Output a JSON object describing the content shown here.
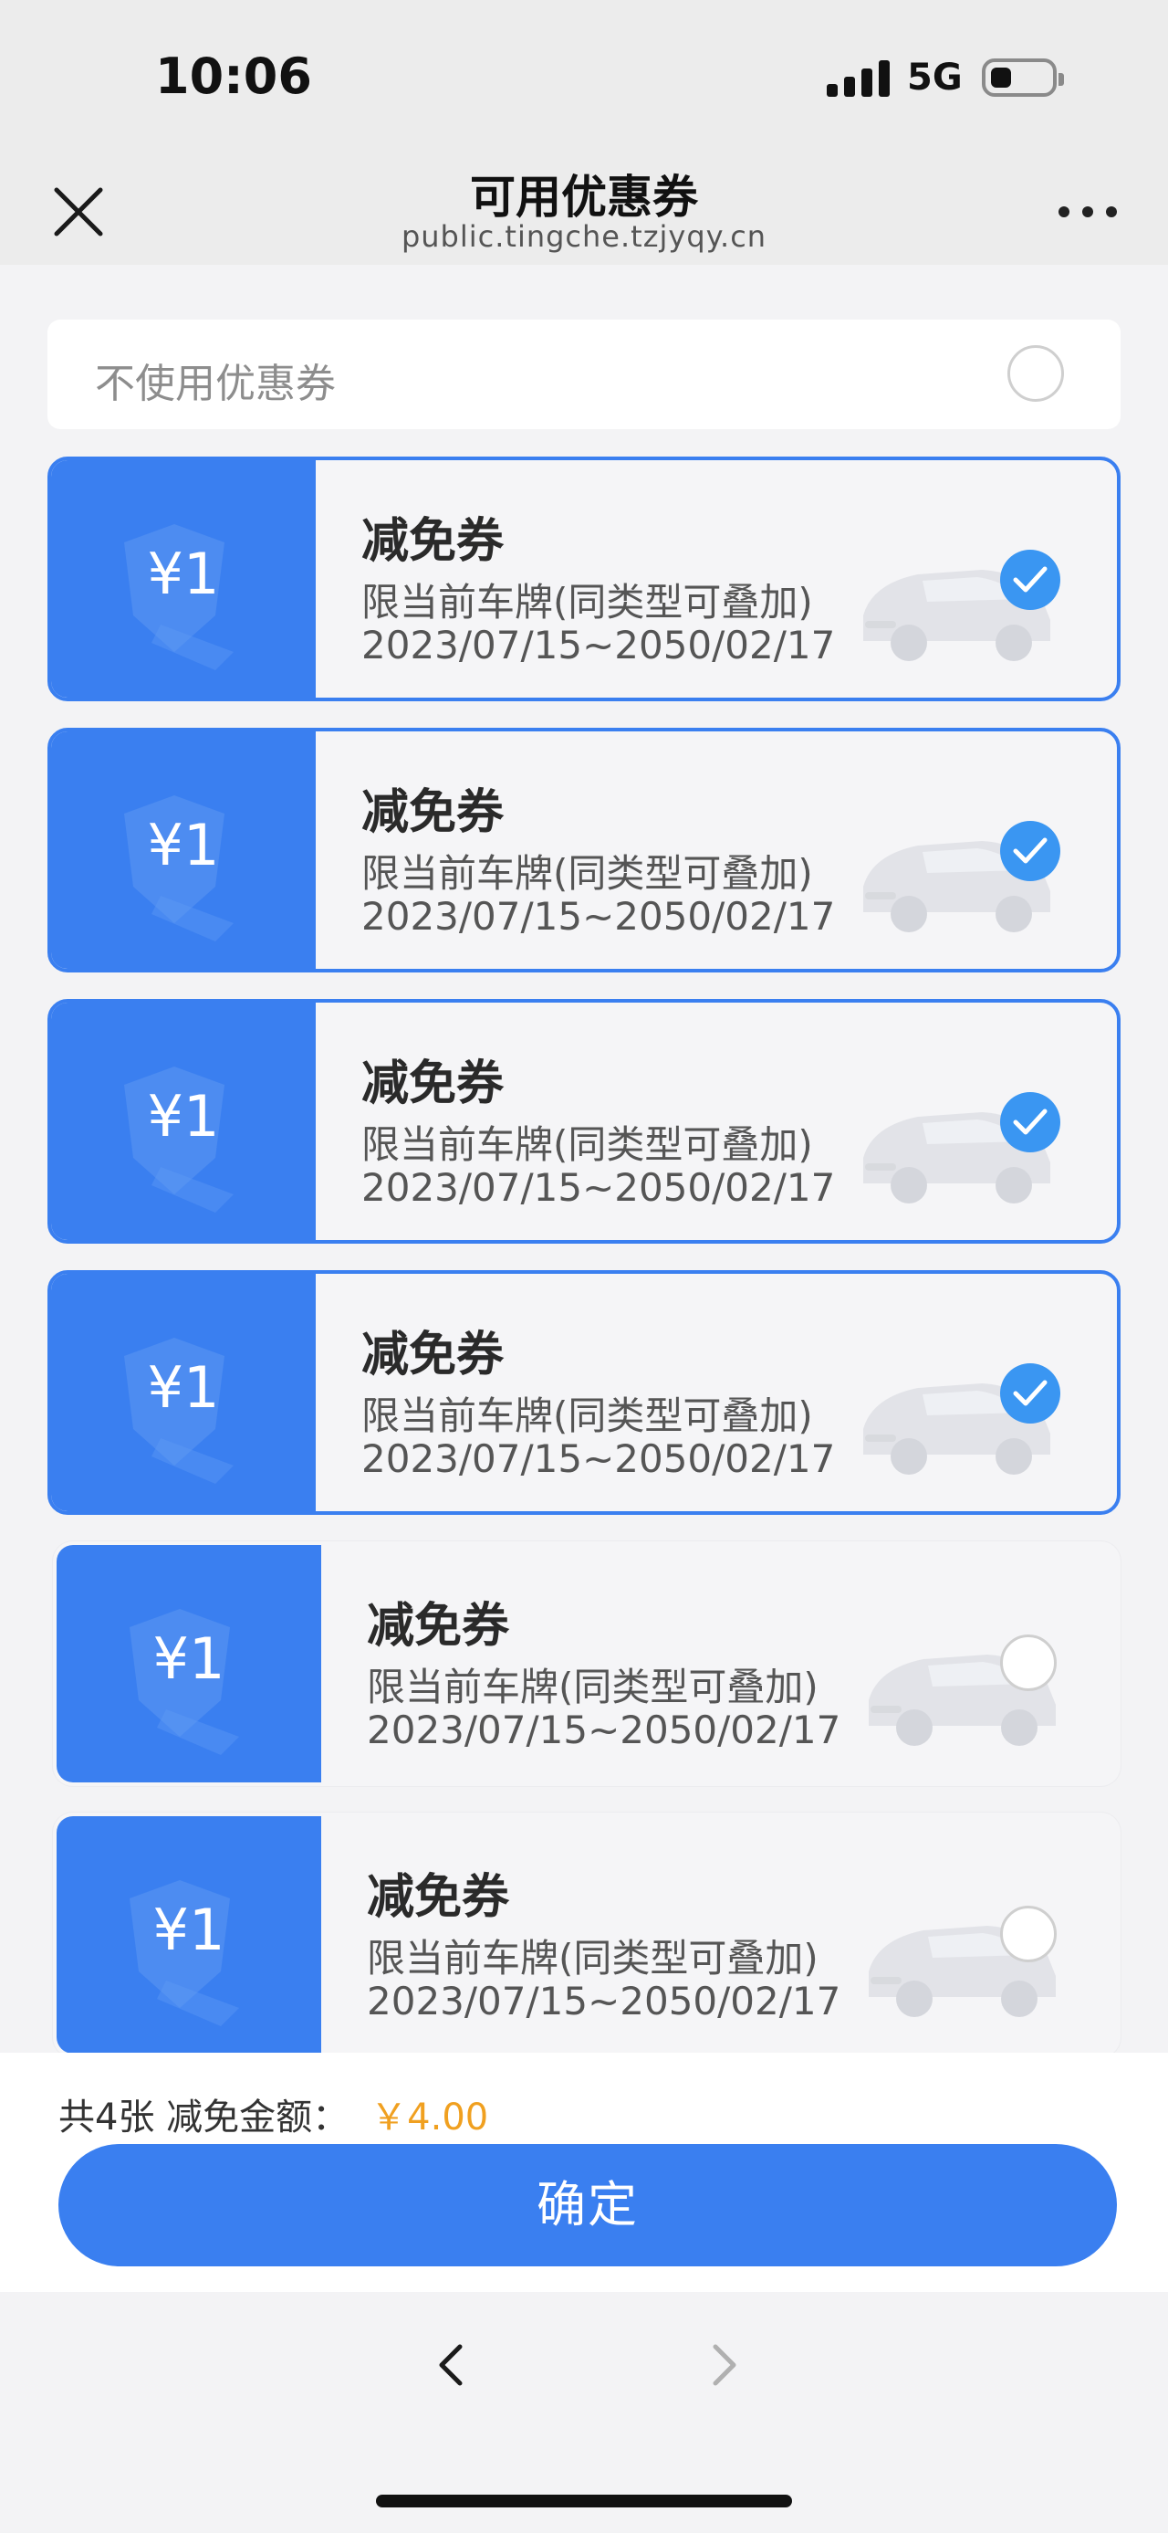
{
  "status_bar": {
    "time": "10:06",
    "network": "5G"
  },
  "header": {
    "title": "可用优惠券",
    "url": "public.tingche.tzjyqy.cn",
    "close_icon": "close-icon",
    "more_icon": "more-icon"
  },
  "no_coupon": {
    "label": "不使用优惠券",
    "selected": false
  },
  "coupons": [
    {
      "amount": "¥1",
      "title": "减免券",
      "desc": "限当前车牌(同类型可叠加)",
      "date": "2023/07/15~2050/02/17",
      "selected": true
    },
    {
      "amount": "¥1",
      "title": "减免券",
      "desc": "限当前车牌(同类型可叠加)",
      "date": "2023/07/15~2050/02/17",
      "selected": true
    },
    {
      "amount": "¥1",
      "title": "减免券",
      "desc": "限当前车牌(同类型可叠加)",
      "date": "2023/07/15~2050/02/17",
      "selected": true
    },
    {
      "amount": "¥1",
      "title": "减免券",
      "desc": "限当前车牌(同类型可叠加)",
      "date": "2023/07/15~2050/02/17",
      "selected": true
    },
    {
      "amount": "¥1",
      "title": "减免券",
      "desc": "限当前车牌(同类型可叠加)",
      "date": "2023/07/15~2050/02/17",
      "selected": false
    },
    {
      "amount": "¥1",
      "title": "减免券",
      "desc": "限当前车牌(同类型可叠加)",
      "date": "2023/07/15~2050/02/17",
      "selected": false
    }
  ],
  "summary": {
    "count_text": "共4张 减免金额：",
    "amount": "￥4.00"
  },
  "confirm_label": "确定",
  "colors": {
    "accent": "#3a7ff0",
    "check": "#3a96f2",
    "amount": "#f0a020"
  }
}
